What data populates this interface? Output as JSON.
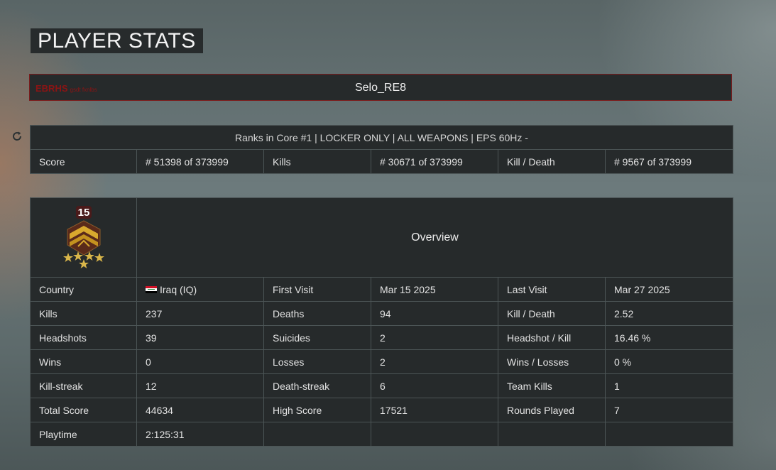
{
  "page_title": "PLAYER STATS",
  "player": {
    "clan_tag": "EBRHS",
    "clan_sub": "gsdt fxnlbs",
    "name": "Selo_RE8"
  },
  "ranks": {
    "header": "Ranks in Core #1 | LOCKER ONLY | ALL WEAPONS | EPS 60Hz -",
    "cells": [
      {
        "label": "Score",
        "value": "# 51398 of 373999"
      },
      {
        "label": "Kills",
        "value": "# 30671 of 373999"
      },
      {
        "label": "Kill / Death",
        "value": "# 9567 of 373999"
      }
    ]
  },
  "badge": {
    "rank_number": "15",
    "stars": 5,
    "colors": {
      "gold": "#d9a92e",
      "dark": "#5a2a1a",
      "rank_bg": "#4a1a1a"
    }
  },
  "overview_title": "Overview",
  "stats_rows": [
    [
      {
        "label": "Country",
        "value": "Iraq (IQ)",
        "flag": true
      },
      {
        "label": "First Visit",
        "value": "Mar 15 2025"
      },
      {
        "label": "Last Visit",
        "value": "Mar 27 2025"
      }
    ],
    [
      {
        "label": "Kills",
        "value": "237"
      },
      {
        "label": "Deaths",
        "value": "94"
      },
      {
        "label": "Kill / Death",
        "value": "2.52"
      }
    ],
    [
      {
        "label": "Headshots",
        "value": "39"
      },
      {
        "label": "Suicides",
        "value": "2"
      },
      {
        "label": "Headshot / Kill",
        "value": "16.46 %"
      }
    ],
    [
      {
        "label": "Wins",
        "value": "0"
      },
      {
        "label": "Losses",
        "value": "2"
      },
      {
        "label": "Wins / Losses",
        "value": "0 %"
      }
    ],
    [
      {
        "label": "Kill-streak",
        "value": "12"
      },
      {
        "label": "Death-streak",
        "value": "6"
      },
      {
        "label": "Team Kills",
        "value": "1"
      }
    ],
    [
      {
        "label": "Total Score",
        "value": "44634"
      },
      {
        "label": "High Score",
        "value": "17521"
      },
      {
        "label": "Rounds Played",
        "value": "7"
      }
    ],
    [
      {
        "label": "Playtime",
        "value": "2:125:31"
      },
      {
        "label": "",
        "value": ""
      },
      {
        "label": "",
        "value": ""
      }
    ]
  ],
  "icons": {
    "refresh": "refresh-icon",
    "flag": "flag-iraq-icon",
    "badge": "rank-badge-icon"
  },
  "colors": {
    "panel_bg": "#262a2b",
    "cell_border": "#4c5556",
    "accent_red": "#8b1414"
  }
}
